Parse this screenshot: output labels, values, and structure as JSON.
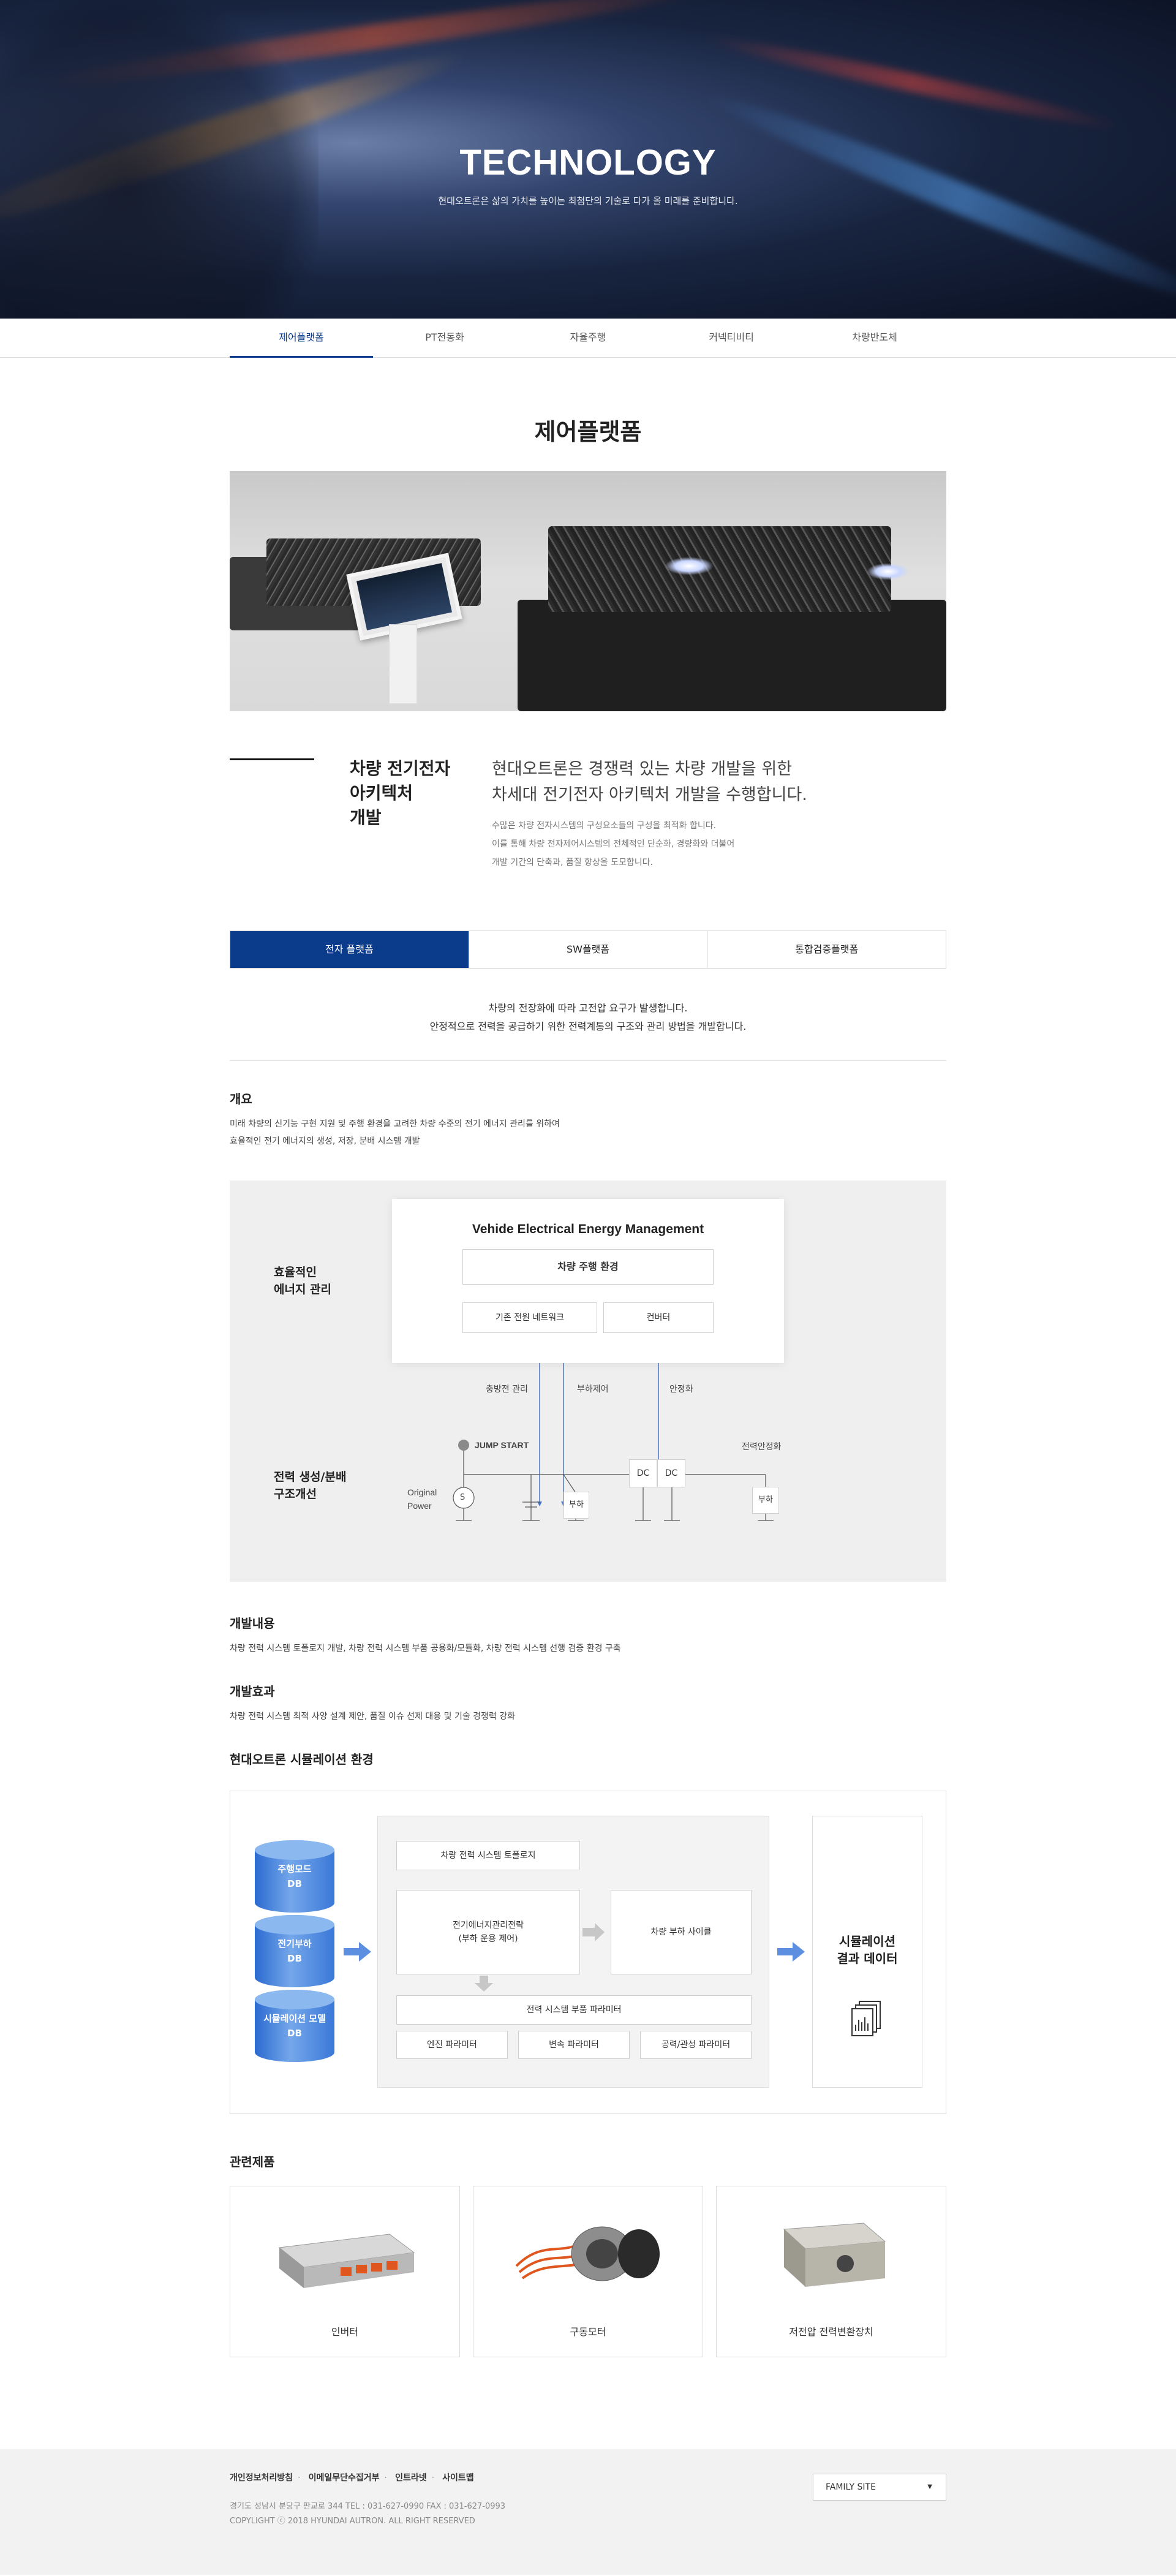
{
  "hero": {
    "title": "TECHNOLOGY",
    "subtitle": "현대오트론은 삶의 가치를 높이는 최첨단의 기술로 다가 올 미래를 준비합니다."
  },
  "tabs": [
    "제어플랫폼",
    "PT전동화",
    "자율주행",
    "커넥티비티",
    "차량반도체"
  ],
  "page_title": "제어플랫폼",
  "intro": {
    "heading": [
      "차량 전기전자",
      "아키텍처",
      "개발"
    ],
    "lead": [
      "현대오트론은 경쟁력 있는 차량 개발을 위한",
      "차세대 전기전자 아키텍처 개발을 수행합니다."
    ],
    "sub": [
      "수많은 차량 전자시스템의 구성요소들의 구성을 최적화 합니다.",
      "이를 통해 차량 전자제어시스템의 전체적인 단순화, 경량화와 더불어",
      "개발 기간의 단축과, 품질 향상을 도모합니다."
    ]
  },
  "subtabs": [
    "전자 플랫폼",
    "SW플랫폼",
    "통합검증플랫폼"
  ],
  "desc": [
    "차량의 전장화에 따라 고전압 요구가 발생합니다.",
    "안정적으로 전력을 공급하기 위한 전력계통의 구조와 관리 방법을 개발합니다."
  ],
  "overview": {
    "title": "개요",
    "text": [
      "미래 차량의 신기능 구현 지원 및 주행 환경을 고려한 차량 수준의 전기 에너지 관리를 위하여",
      "효율적인 전기 에너지의 생성, 저장, 분배 시스템 개발"
    ]
  },
  "diagram": {
    "label_top": [
      "효율적인",
      "에너지 관리"
    ],
    "label_bottom": [
      "전력 생성/분배",
      "구조개선"
    ],
    "card_title": "Vehide Electrical Energy Management",
    "env": "차량 주행 환경",
    "network": "기존 전원 네트워크",
    "converter": "컨버터",
    "c1": "충방전 관리",
    "c2": "부하제어",
    "c3": "안정화",
    "jump": "JUMP START",
    "stab": "전력안정화",
    "original": [
      "Original",
      "Power"
    ],
    "s": "S",
    "load": "부하",
    "dc": "DC"
  },
  "content": {
    "title": "개발내용",
    "text": "차량 전력 시스템 토폴로지 개발, 차량 전력 시스템 부품 공용화/모듈화, 차량 전력 시스템 선행 검증 환경 구축"
  },
  "effect": {
    "title": "개발효과",
    "text": "차량 전력 시스템 최적 사양 설계 제안, 품질 이슈 선제 대응 및 기술 경쟁력 강화"
  },
  "sim": {
    "title": "현대오트론 시뮬레이션 환경",
    "db": [
      [
        "주행모드",
        "DB"
      ],
      [
        "전기부하",
        "DB"
      ],
      [
        "시뮬레이션 모델",
        "DB"
      ]
    ],
    "topology": "차량 전력 시스템 토폴로지",
    "strategy": [
      "전기에너지관리전략",
      "(부하 운용 제어)"
    ],
    "cycle": "차량 부하 사이클",
    "params": "전력 시스템 부품 파라미터",
    "p1": "엔진 파라미터",
    "p2": "변속 파라미터",
    "p3": "공력/관성 파라미터",
    "result": [
      "시뮬레이션",
      "결과 데이터"
    ]
  },
  "products": {
    "title": "관련제품",
    "items": [
      "인버터",
      "구동모터",
      "저전압 전력변환장치"
    ]
  },
  "footer": {
    "links": [
      "개인정보처리방침",
      "이메일무단수집거부",
      "인트라넷",
      "사이트맵"
    ],
    "address": "경기도 성남시 분당구 판교로 344    TEL : 031-627-0990    FAX : 031-627-0993",
    "copyright": "COPYLIGHT ⓒ 2018 HYUNDAI AUTRON. ALL RIGHT RESERVED",
    "family": "FAMILY SITE"
  }
}
